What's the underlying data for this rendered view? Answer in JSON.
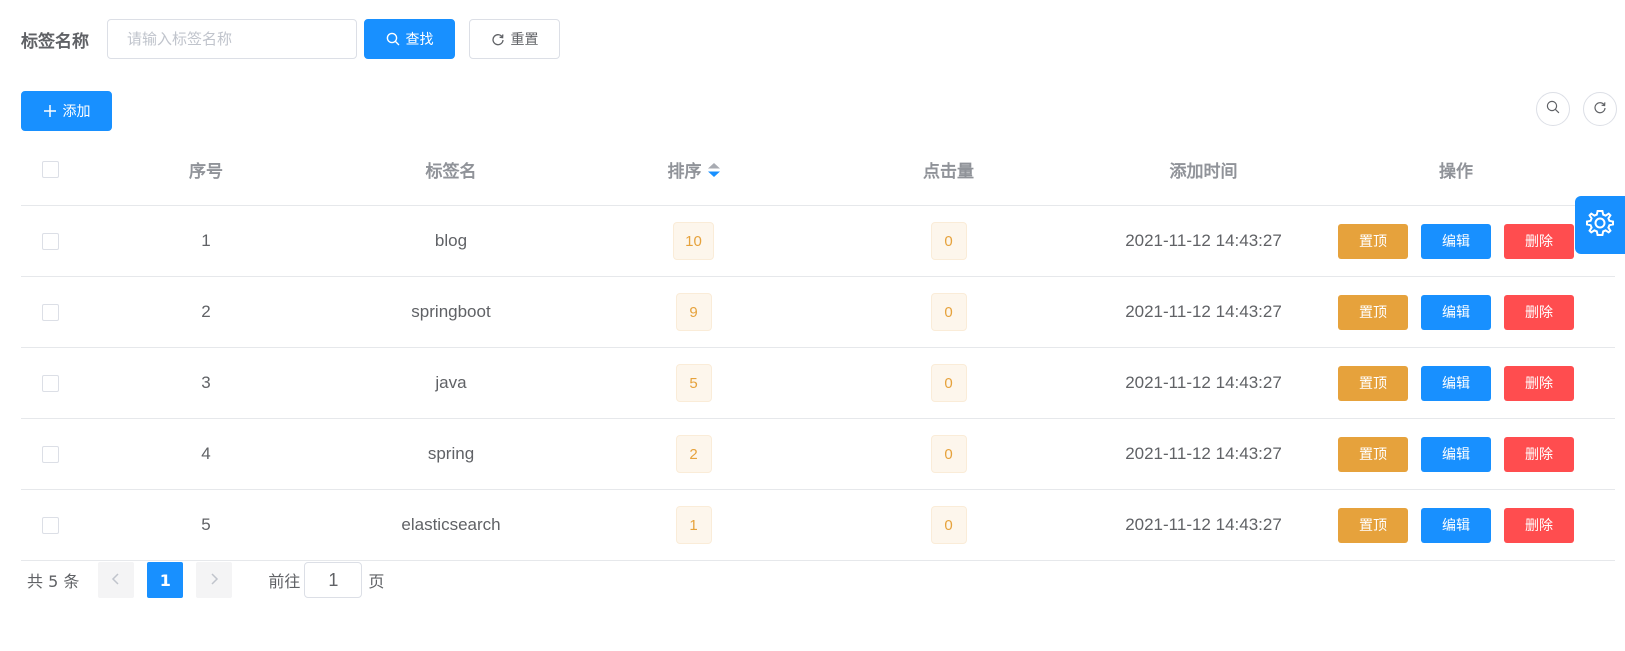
{
  "search": {
    "label": "标签名称",
    "placeholder": "请输入标签名称",
    "find_label": "查找",
    "reset_label": "重置"
  },
  "toolbar": {
    "add_label": "添加"
  },
  "table": {
    "headers": {
      "seq": "序号",
      "name": "标签名",
      "sort": "排序",
      "clicks": "点击量",
      "time": "添加时间",
      "ops": "操作"
    },
    "rows": [
      {
        "seq": "1",
        "name": "blog",
        "sort": "10",
        "clicks": "0",
        "time": "2021-11-12 14:43:27"
      },
      {
        "seq": "2",
        "name": "springboot",
        "sort": "9",
        "clicks": "0",
        "time": "2021-11-12 14:43:27"
      },
      {
        "seq": "3",
        "name": "java",
        "sort": "5",
        "clicks": "0",
        "time": "2021-11-12 14:43:27"
      },
      {
        "seq": "4",
        "name": "spring",
        "sort": "2",
        "clicks": "0",
        "time": "2021-11-12 14:43:27"
      },
      {
        "seq": "5",
        "name": "elasticsearch",
        "sort": "1",
        "clicks": "0",
        "time": "2021-11-12 14:43:27"
      }
    ],
    "ops": {
      "top": "置顶",
      "edit": "编辑",
      "delete": "删除"
    }
  },
  "pagination": {
    "total": "共 5 条",
    "current_page": "1",
    "goto_prefix": "前往",
    "goto_value": "1",
    "goto_suffix": "页"
  },
  "colors": {
    "primary": "#1890ff",
    "warning": "#e6a23c",
    "danger": "#ff4d4f"
  }
}
